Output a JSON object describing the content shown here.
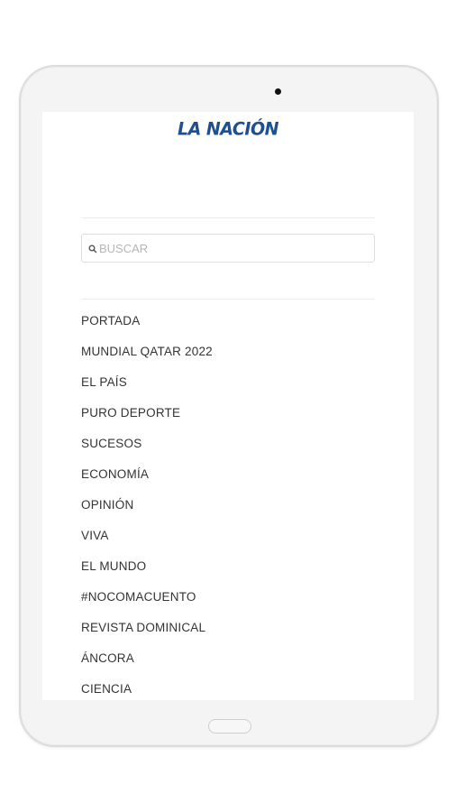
{
  "header": {
    "logo_text": "LA NACIÓN"
  },
  "search": {
    "placeholder": "BUSCAR",
    "value": ""
  },
  "menu": {
    "items": [
      {
        "label": "PORTADA"
      },
      {
        "label": "MUNDIAL QATAR 2022"
      },
      {
        "label": "EL PAÍS"
      },
      {
        "label": "PURO DEPORTE"
      },
      {
        "label": "SUCESOS"
      },
      {
        "label": "ECONOMÍA"
      },
      {
        "label": "OPINIÓN"
      },
      {
        "label": "VIVA"
      },
      {
        "label": "EL MUNDO"
      },
      {
        "label": "#NOCOMACUENTO"
      },
      {
        "label": "REVISTA DOMINICAL"
      },
      {
        "label": "ÁNCORA"
      },
      {
        "label": "CIENCIA"
      }
    ]
  },
  "colors": {
    "brand": "#1d4f91",
    "text": "#333333",
    "placeholder": "#b5b5b5"
  }
}
